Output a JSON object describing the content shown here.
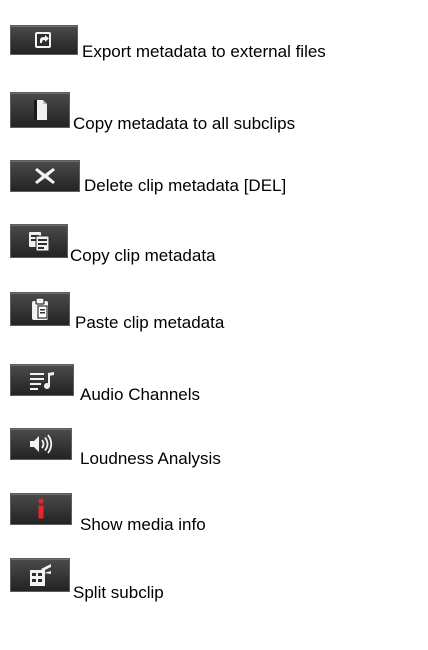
{
  "items": [
    {
      "label": "Export metadata to external files",
      "icon": "export-icon"
    },
    {
      "label": "Copy metadata to all subclips",
      "icon": "document-icon"
    },
    {
      "label": "Delete clip metadata [DEL]",
      "icon": "delete-x-icon"
    },
    {
      "label": "Copy clip metadata",
      "icon": "copy-icon"
    },
    {
      "label": "Paste clip metadata",
      "icon": "paste-clipboard-icon"
    },
    {
      "label": "Audio Channels",
      "icon": "audio-channels-icon"
    },
    {
      "label": "Loudness Analysis",
      "icon": "speaker-icon"
    },
    {
      "label": "Show media info",
      "icon": "info-icon"
    },
    {
      "label": "Split subclip",
      "icon": "split-clip-icon"
    }
  ],
  "colors": {
    "button_dark": "#232323",
    "icon_light": "#f2f2f2",
    "info_red": "#e8262a"
  }
}
